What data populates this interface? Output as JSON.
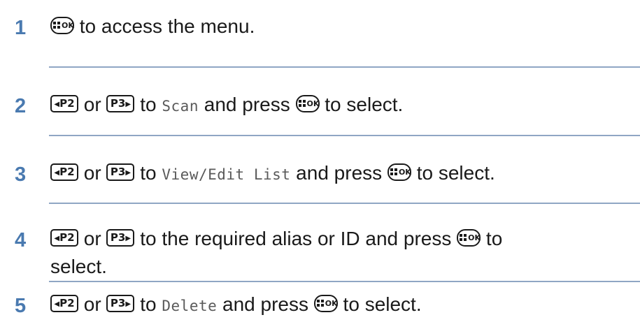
{
  "steps": [
    {
      "number": "1",
      "segments": [
        {
          "type": "key",
          "icon": "ok-menu-key-icon",
          "label": "OK"
        },
        {
          "type": "text",
          "text": " to access the menu."
        }
      ]
    },
    {
      "number": "2",
      "segments": [
        {
          "type": "key",
          "icon": "p2-left-key-icon",
          "label": "P2"
        },
        {
          "type": "text",
          "text": " or "
        },
        {
          "type": "key",
          "icon": "p3-right-key-icon",
          "label": "P3"
        },
        {
          "type": "text",
          "text": " to "
        },
        {
          "type": "mono",
          "text": "Scan"
        },
        {
          "type": "text",
          "text": " and press "
        },
        {
          "type": "key",
          "icon": "ok-menu-key-icon",
          "label": "OK"
        },
        {
          "type": "text",
          "text": " to select."
        }
      ]
    },
    {
      "number": "3",
      "segments": [
        {
          "type": "key",
          "icon": "p2-left-key-icon",
          "label": "P2"
        },
        {
          "type": "text",
          "text": " or "
        },
        {
          "type": "key",
          "icon": "p3-right-key-icon",
          "label": "P3"
        },
        {
          "type": "text",
          "text": " to "
        },
        {
          "type": "mono",
          "text": "View/Edit List"
        },
        {
          "type": "text",
          "text": " and press "
        },
        {
          "type": "key",
          "icon": "ok-menu-key-icon",
          "label": "OK"
        },
        {
          "type": "text",
          "text": " to select."
        }
      ]
    },
    {
      "number": "4",
      "segments": [
        {
          "type": "key",
          "icon": "p2-left-key-icon",
          "label": "P2"
        },
        {
          "type": "text",
          "text": " or "
        },
        {
          "type": "key",
          "icon": "p3-right-key-icon",
          "label": "P3"
        },
        {
          "type": "text",
          "text": " to the required alias or ID and press "
        },
        {
          "type": "key",
          "icon": "ok-menu-key-icon",
          "label": "OK"
        },
        {
          "type": "text",
          "text": " to"
        }
      ],
      "continuation": "select."
    },
    {
      "number": "5",
      "segments": [
        {
          "type": "key",
          "icon": "p2-left-key-icon",
          "label": "P2"
        },
        {
          "type": "text",
          "text": " or "
        },
        {
          "type": "key",
          "icon": "p3-right-key-icon",
          "label": "P3"
        },
        {
          "type": "text",
          "text": " to "
        },
        {
          "type": "mono",
          "text": "Delete"
        },
        {
          "type": "text",
          "text": " and press "
        },
        {
          "type": "key",
          "icon": "ok-menu-key-icon",
          "label": "OK"
        },
        {
          "type": "text",
          "text": " to select."
        }
      ]
    }
  ],
  "colors": {
    "step_number": "#4a7ab0",
    "divider": "#8fa6c4",
    "text": "#1a1a1a",
    "mono_text": "#5a5a5a"
  }
}
